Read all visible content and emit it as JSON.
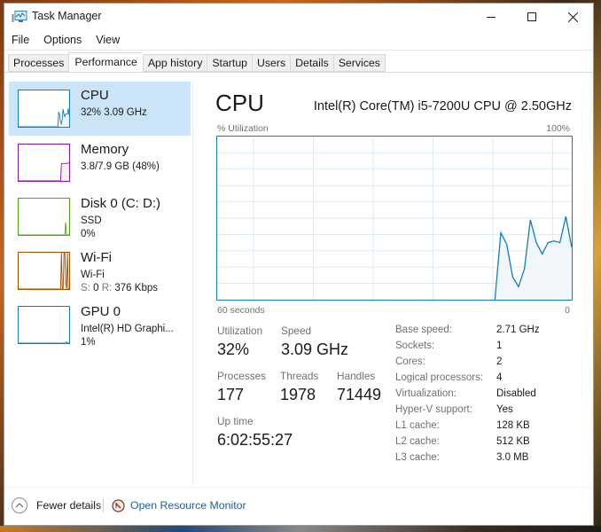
{
  "window": {
    "title": "Task Manager",
    "icon": "task-manager-icon",
    "controls": [
      "minimize-icon",
      "maximize-icon",
      "close-icon"
    ]
  },
  "menu": [
    {
      "label": "File"
    },
    {
      "label": "Options"
    },
    {
      "label": "View"
    }
  ],
  "tabs": [
    {
      "label": "Processes",
      "active": false
    },
    {
      "label": "Performance",
      "active": true
    },
    {
      "label": "App history",
      "active": false
    },
    {
      "label": "Startup",
      "active": false
    },
    {
      "label": "Users",
      "active": false
    },
    {
      "label": "Details",
      "active": false
    },
    {
      "label": "Services",
      "active": false
    }
  ],
  "sidebar": {
    "items": [
      {
        "name": "CPU",
        "sub1": "32% 3.09 GHz",
        "sub2": "",
        "color": "#117dbb",
        "fill": "#f1f6fa",
        "active": true,
        "spark": [
          0,
          0,
          0,
          0,
          0,
          0,
          0,
          0,
          0,
          0,
          0,
          0,
          0,
          0,
          0,
          0,
          0,
          0,
          0,
          0,
          0,
          0,
          0,
          0,
          0,
          0,
          0,
          0,
          0,
          0,
          0,
          0,
          0,
          0,
          0,
          0,
          0,
          0,
          0,
          0,
          0,
          0,
          0,
          0,
          0,
          0,
          41,
          34,
          14,
          8,
          19,
          49,
          35,
          28,
          35,
          36,
          35,
          51,
          32
        ]
      },
      {
        "name": "Memory",
        "sub1": "3.8/7.9 GB (48%)",
        "sub2": "",
        "color": "#8b12ae",
        "fill": "#f4f2f4",
        "active": false,
        "spark": [
          0,
          0,
          0,
          0,
          0,
          0,
          0,
          0,
          0,
          0,
          0,
          0,
          0,
          0,
          0,
          0,
          0,
          0,
          0,
          0,
          0,
          0,
          0,
          0,
          0,
          0,
          0,
          0,
          0,
          0,
          0,
          0,
          0,
          0,
          0,
          0,
          0,
          0,
          0,
          0,
          0,
          0,
          0,
          0,
          0,
          0,
          0,
          0,
          0,
          0,
          48,
          48,
          48,
          48,
          48,
          48,
          48,
          49,
          49,
          49
        ]
      },
      {
        "name": "Disk 0 (C: D:)",
        "sub1": "SSD",
        "sub2": "0%",
        "color": "#4da60c",
        "fill": "#eff7e6",
        "active": false,
        "spark": [
          0,
          0,
          0,
          0,
          0,
          0,
          0,
          0,
          0,
          0,
          0,
          0,
          0,
          0,
          0,
          0,
          0,
          0,
          0,
          0,
          0,
          0,
          0,
          0,
          0,
          0,
          0,
          0,
          0,
          0,
          0,
          0,
          0,
          0,
          0,
          0,
          0,
          0,
          0,
          0,
          0,
          0,
          0,
          0,
          0,
          0,
          0,
          0,
          0,
          0,
          0,
          0,
          0,
          0,
          0,
          35,
          0,
          0,
          0,
          0
        ]
      },
      {
        "name": "Wi-Fi",
        "sub1": "Wi-Fi",
        "sub2_label_send": "S:",
        "sub2_send": "0",
        "sub2_label_recv": "R:",
        "sub2_recv": "376 Kbps",
        "color": "#a74f01",
        "fill": "#fcf3eb",
        "active": false,
        "spark": [
          0,
          0,
          0,
          0,
          0,
          0,
          0,
          0,
          0,
          0,
          0,
          0,
          0,
          0,
          0,
          0,
          0,
          0,
          0,
          0,
          0,
          0,
          0,
          0,
          0,
          0,
          0,
          0,
          0,
          0,
          0,
          0,
          0,
          0,
          0,
          0,
          0,
          0,
          0,
          0,
          0,
          0,
          0,
          0,
          0,
          0,
          0,
          0,
          0,
          0,
          100,
          0,
          0,
          100,
          100,
          20,
          0,
          100,
          0,
          0
        ]
      },
      {
        "name": "GPU 0",
        "sub1": "Intel(R) HD Graphi...",
        "sub2": "1%",
        "color": "#117dbb",
        "fill": "#f1f6fa",
        "active": false,
        "spark": [
          0,
          0,
          0,
          0,
          0,
          0,
          0,
          0,
          0,
          0,
          0,
          0,
          0,
          0,
          0,
          0,
          0,
          0,
          0,
          0,
          0,
          0,
          0,
          0,
          0,
          0,
          0,
          0,
          0,
          0,
          0,
          0,
          0,
          0,
          0,
          0,
          0,
          0,
          0,
          0,
          0,
          0,
          0,
          0,
          0,
          0,
          0,
          0,
          0,
          0,
          0,
          0,
          0,
          0,
          0,
          0,
          4,
          0,
          0,
          1
        ]
      }
    ]
  },
  "main": {
    "title": "CPU",
    "model": "Intel(R) Core(TM) i5-7200U CPU @ 2.50GHz",
    "stats": {
      "utilization_label": "Utilization",
      "utilization": "32%",
      "speed_label": "Speed",
      "speed": "3.09 GHz",
      "processes_label": "Processes",
      "processes": "177",
      "threads_label": "Threads",
      "threads": "1978",
      "handles_label": "Handles",
      "handles": "71449",
      "uptime_label": "Up time",
      "uptime": "6:02:55:27"
    },
    "specs": [
      {
        "label": "Base speed:",
        "value": "2.71 GHz"
      },
      {
        "label": "Sockets:",
        "value": "1"
      },
      {
        "label": "Cores:",
        "value": "2"
      },
      {
        "label": "Logical processors:",
        "value": "4"
      },
      {
        "label": "Virtualization:",
        "value": "Disabled"
      },
      {
        "label": "Hyper-V support:",
        "value": "Yes"
      },
      {
        "label": "L1 cache:",
        "value": "128 KB"
      },
      {
        "label": "L2 cache:",
        "value": "512 KB"
      },
      {
        "label": "L3 cache:",
        "value": "3.0 MB"
      }
    ]
  },
  "chart_data": {
    "type": "area",
    "title": "% Utilization",
    "ylabel": "% Utilization",
    "ymax_label": "100%",
    "xlabel_left": "60 seconds",
    "xlabel_right": "0",
    "ylim": [
      0,
      100
    ],
    "xlim": [
      60,
      0
    ],
    "grid": true,
    "grid_rows": 10,
    "grid_cols": 6,
    "line_color": "#117dbb",
    "fill_color": "#f1f6fa",
    "grid_color": "#d9eaf4",
    "series": [
      {
        "name": "CPU",
        "x_seconds_ago": [
          13,
          12,
          11,
          10,
          9,
          8,
          7,
          6,
          5,
          4,
          3,
          2,
          1,
          0
        ],
        "values": [
          0,
          41,
          34,
          14,
          8,
          19,
          49,
          35,
          28,
          35,
          36,
          35,
          51,
          32
        ]
      }
    ]
  },
  "footer": {
    "fewer_details": "Fewer details",
    "open_resource_monitor": "Open Resource Monitor"
  }
}
